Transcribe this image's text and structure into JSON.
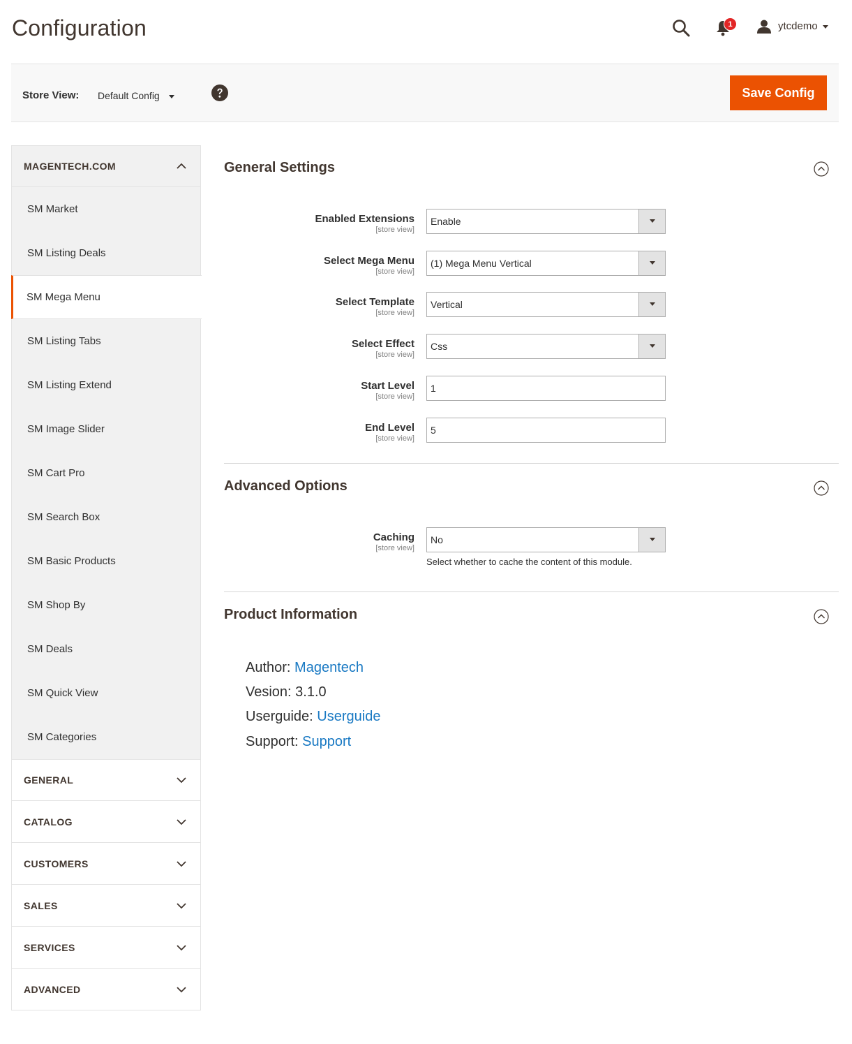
{
  "header": {
    "title": "Configuration",
    "notification_count": "1",
    "user_name": "ytcdemo"
  },
  "store_bar": {
    "label": "Store View:",
    "value": "Default Config",
    "save_label": "Save Config"
  },
  "sidebar": {
    "expanded_section": "MAGENTECH.COM",
    "items": [
      {
        "label": "SM Market"
      },
      {
        "label": "SM Listing Deals"
      },
      {
        "label": "SM Mega Menu",
        "active": true
      },
      {
        "label": "SM Listing Tabs"
      },
      {
        "label": "SM Listing Extend"
      },
      {
        "label": "SM Image Slider"
      },
      {
        "label": "SM Cart Pro"
      },
      {
        "label": "SM Search Box"
      },
      {
        "label": "SM Basic Products"
      },
      {
        "label": "SM Shop By"
      },
      {
        "label": "SM Deals"
      },
      {
        "label": "SM Quick View"
      },
      {
        "label": "SM Categories"
      }
    ],
    "collapsed_sections": [
      "GENERAL",
      "CATALOG",
      "CUSTOMERS",
      "SALES",
      "SERVICES",
      "ADVANCED"
    ]
  },
  "general_settings": {
    "title": "General Settings",
    "scope": "[store view]",
    "fields": [
      {
        "label": "Enabled Extensions",
        "value": "Enable"
      },
      {
        "label": "Select Mega Menu",
        "value": "(1) Mega Menu Vertical"
      },
      {
        "label": "Select Template",
        "value": "Vertical"
      },
      {
        "label": "Select Effect",
        "value": "Css"
      },
      {
        "label": "Start Level",
        "value": "1"
      },
      {
        "label": "End Level",
        "value": "5"
      }
    ]
  },
  "advanced_options": {
    "title": "Advanced Options",
    "caching_label": "Caching",
    "caching_scope": "[store view]",
    "caching_value": "No",
    "caching_note": "Select whether to cache the content of this module."
  },
  "product_info": {
    "title": "Product Information",
    "author_label": "Author:",
    "author_link": "Magentech",
    "version_label": "Vesion:",
    "version_value": "3.1.0",
    "userguide_label": "Userguide:",
    "userguide_link": "Userguide",
    "support_label": "Support:",
    "support_link": "Support"
  },
  "colors": {
    "accent": "#eb5202",
    "link": "#1979c3",
    "badge": "#e22626"
  }
}
